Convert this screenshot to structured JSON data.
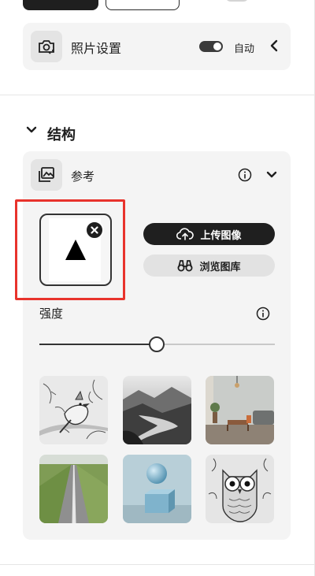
{
  "photo_settings": {
    "label": "照片设置",
    "auto_label": "自动"
  },
  "structure": {
    "title": "结构",
    "reference": {
      "label": "参考",
      "upload_label": "上传图像",
      "browse_label": "浏览图库"
    },
    "strength": {
      "label": "强度",
      "value": 0.5
    },
    "samples": [
      {
        "name": "bird-sketch"
      },
      {
        "name": "misty-river"
      },
      {
        "name": "living-room"
      },
      {
        "name": "road-field"
      },
      {
        "name": "sphere-on-cube"
      },
      {
        "name": "owl-sketch"
      }
    ]
  },
  "colors": {
    "highlight": "#e8332c",
    "panel": "#f4f4f4",
    "dark": "#1f1f1f"
  }
}
